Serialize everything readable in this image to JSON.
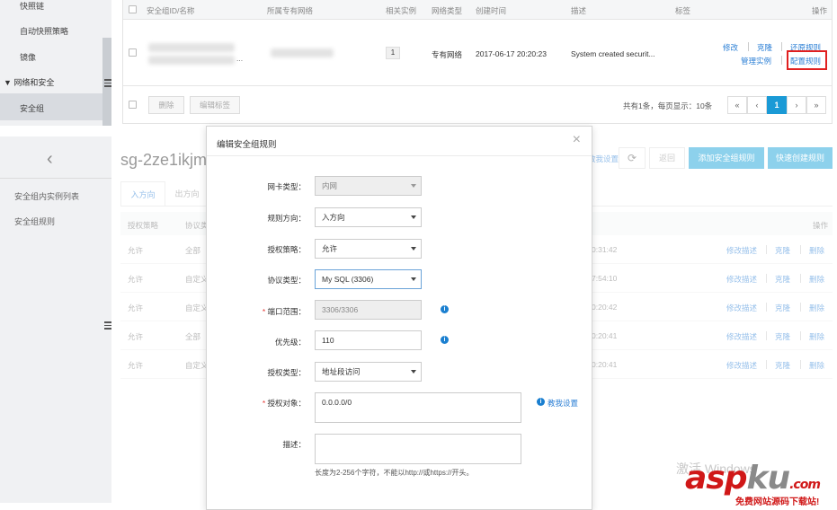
{
  "top_sidebar": {
    "items": [
      {
        "label": "快照链"
      },
      {
        "label": "自动快照策略"
      },
      {
        "label": "镜像"
      }
    ],
    "group": "网络和安全",
    "active_item": "安全组"
  },
  "top_table": {
    "headers": [
      "安全组ID/名称",
      "所属专有网络",
      "相关实例",
      "网络类型",
      "创建时间",
      "描述",
      "标签",
      "操作"
    ],
    "row": {
      "related_instances": "1",
      "network_type": "专有网络",
      "created": "2017-06-17 20:20:23",
      "description": "System created securit...",
      "name_suffix": "...",
      "actions": [
        "修改",
        "克隆",
        "还原规则",
        "管理实例",
        "配置规则"
      ]
    },
    "footer": {
      "delete_label": "删除",
      "edit_tags_label": "编辑标签",
      "summary": "共有1条，每页显示：10条",
      "pager": [
        "«",
        "‹",
        "1",
        "›",
        "»"
      ]
    }
  },
  "bottom": {
    "back_icon": "‹",
    "sidebar_items": [
      "安全组内实例列表",
      "安全组规则"
    ],
    "page_title": "sg-2ze1ikjm0",
    "tabs": [
      "入方向",
      "出方向"
    ],
    "toolbar": {
      "teach_label": "教我设置",
      "refresh_icon": "⟳",
      "back_label": "返回",
      "add_rule_label": "添加安全组规则",
      "quick_create_label": "快速创建规则"
    },
    "table_headers": [
      "授权策略",
      "协议类",
      "操作"
    ],
    "rows": [
      {
        "policy": "允许",
        "proto": "全部",
        "time": "0:31:42"
      },
      {
        "policy": "允许",
        "proto": "自定义",
        "time": "7:54:10"
      },
      {
        "policy": "允许",
        "proto": "自定义",
        "time": "0:20:42"
      },
      {
        "policy": "允许",
        "proto": "全部",
        "time": "0:20:41"
      },
      {
        "policy": "允许",
        "proto": "自定义",
        "time": "0:20:41"
      }
    ],
    "row_actions": [
      "修改描述",
      "克隆",
      "删除"
    ]
  },
  "modal": {
    "title": "编辑安全组规则",
    "close_icon": "×",
    "fields": {
      "nic_type": {
        "label": "网卡类型：",
        "value": "内网"
      },
      "direction": {
        "label": "规则方向：",
        "value": "入方向"
      },
      "policy": {
        "label": "授权策略：",
        "value": "允许"
      },
      "protocol": {
        "label": "协议类型：",
        "value": "My SQL (3306)"
      },
      "port_range": {
        "label": "端口范围：",
        "value": "3306/3306"
      },
      "priority": {
        "label": "优先级：",
        "value": "110"
      },
      "auth_type": {
        "label": "授权类型：",
        "value": "地址段访问"
      },
      "auth_object": {
        "label": "授权对象：",
        "value": "0.0.0.0/0"
      },
      "description": {
        "label": "描述：",
        "value": ""
      }
    },
    "teach_me_label": "教我设置",
    "desc_hint": "长度为2-256个字符，不能以http://或https://开头。"
  },
  "watermark": {
    "faded_text": "激活 Windows",
    "asp": "asp",
    "ku": "ku",
    "com": ".com",
    "sub": "免费网站源码下载站!"
  },
  "colors": {
    "primary": "#1aa3d8",
    "link": "#2b7fd5",
    "highlight_box": "#e02020",
    "watermark_red": "#d01818"
  }
}
